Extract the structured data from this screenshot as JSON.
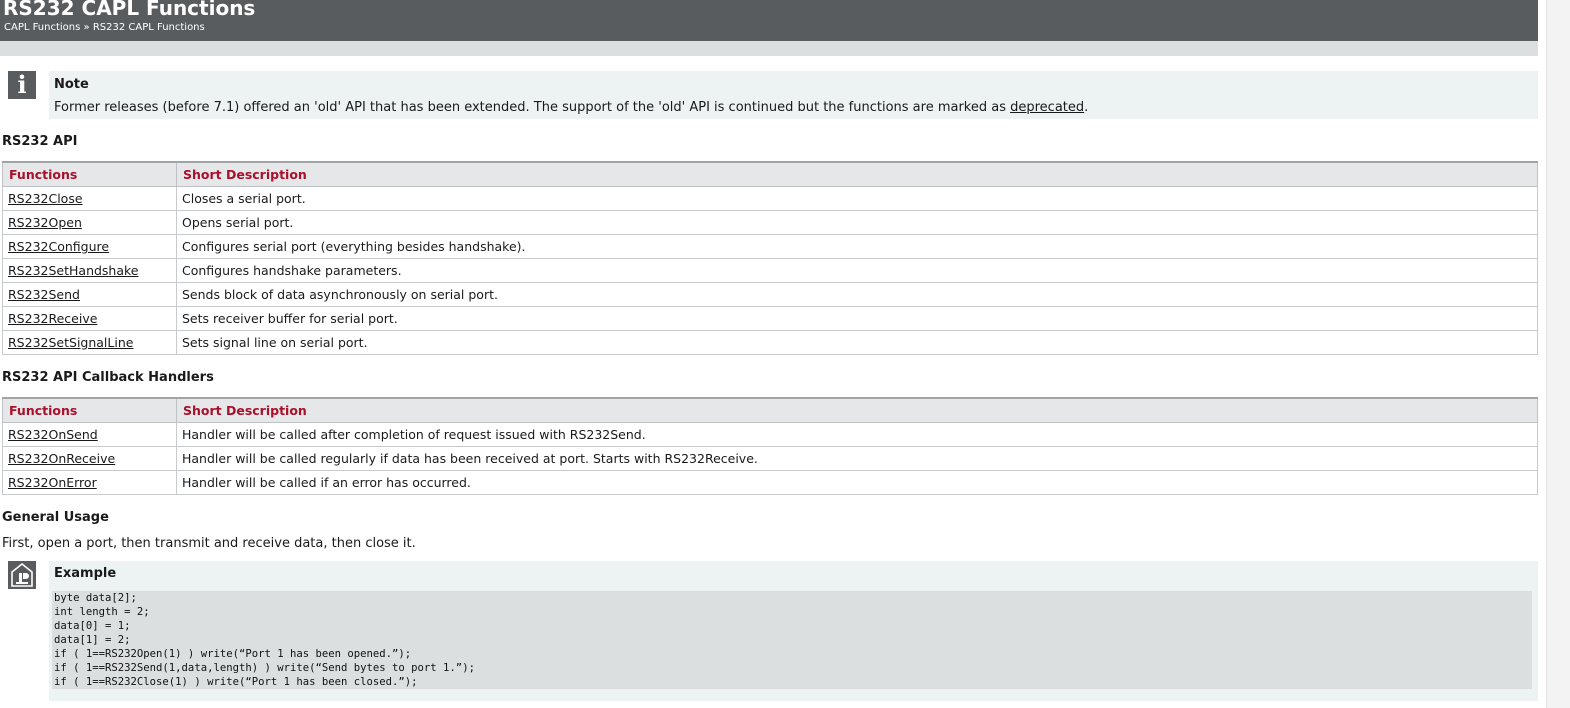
{
  "header": {
    "title": "RS232 CAPL Functions",
    "breadcrumb": "CAPL Functions » RS232 CAPL Functions"
  },
  "note": {
    "icon": "info-icon",
    "title": "Note",
    "text": "Former releases (before 7.1) offered an 'old' API that has been extended. The support of the 'old' API is continued but the functions are marked as ",
    "link": "deprecated",
    "suffix": "."
  },
  "api": {
    "title": "RS232 API",
    "headers": [
      "Functions",
      "Short Description"
    ],
    "rows": [
      {
        "name": "RS232Close",
        "desc": "Closes a serial port."
      },
      {
        "name": "RS232Open",
        "desc": "Opens serial port."
      },
      {
        "name": "RS232Configure",
        "desc": "Configures serial port (everything besides handshake)."
      },
      {
        "name": "RS232SetHandshake",
        "desc": "Configures handshake parameters."
      },
      {
        "name": "RS232Send",
        "desc": "Sends block of data asynchronously on serial port."
      },
      {
        "name": "RS232Receive",
        "desc": "Sets receiver buffer for serial port."
      },
      {
        "name": "RS232SetSignalLine",
        "desc": "Sets signal line on serial port."
      }
    ]
  },
  "callbacks": {
    "title": "RS232 API Callback Handlers",
    "headers": [
      "Functions",
      "Short Description"
    ],
    "rows": [
      {
        "name": "RS232OnSend",
        "desc": "Handler will be called after completion of request issued with RS232Send."
      },
      {
        "name": "RS232OnReceive",
        "desc": "Handler will be called regularly if data has been received at port. Starts with RS232Receive."
      },
      {
        "name": "RS232OnError",
        "desc": "Handler will be called if an error has occurred."
      }
    ]
  },
  "usage": {
    "title": "General Usage",
    "text": "First, open a port, then transmit and receive data, then close it."
  },
  "example": {
    "icon": "example-icon",
    "title": "Example",
    "code": [
      "byte data[2];",
      "int length = 2;",
      "data[0] = 1;",
      "data[1] = 2;",
      "if ( 1==RS232Open(1) ) write(“Port 1 has been opened.”);",
      "if ( 1==RS232Send(1,data,length) ) write(“Send bytes to port 1.”);",
      "if ( 1==RS232Close(1) ) write(“Port 1 has been closed.”);"
    ]
  },
  "colors": {
    "header_bg": "#595c5e",
    "table_header_text": "#a8102c",
    "box_bg": "#edf2f2",
    "code_bg": "#dcdfe0"
  }
}
